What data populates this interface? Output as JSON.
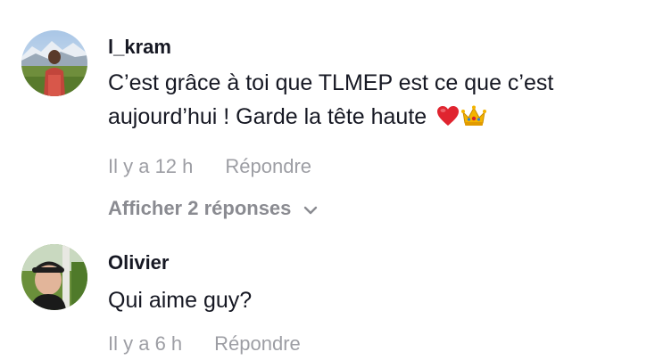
{
  "comments": [
    {
      "username": "l_kram",
      "text_line1": "C’est grâce à toi que TLMEP est ce que c’est",
      "text_line2": "aujourd’hui ! Garde la tête haute",
      "emojis": [
        "red-heart",
        "crown"
      ],
      "time": "Il y a 12 h",
      "reply_label": "Répondre",
      "view_replies_label": "Afficher 2 réponses"
    },
    {
      "username": "Olivier",
      "text": "Qui aime guy?",
      "time": "Il y a 6 h",
      "reply_label": "Répondre"
    }
  ]
}
